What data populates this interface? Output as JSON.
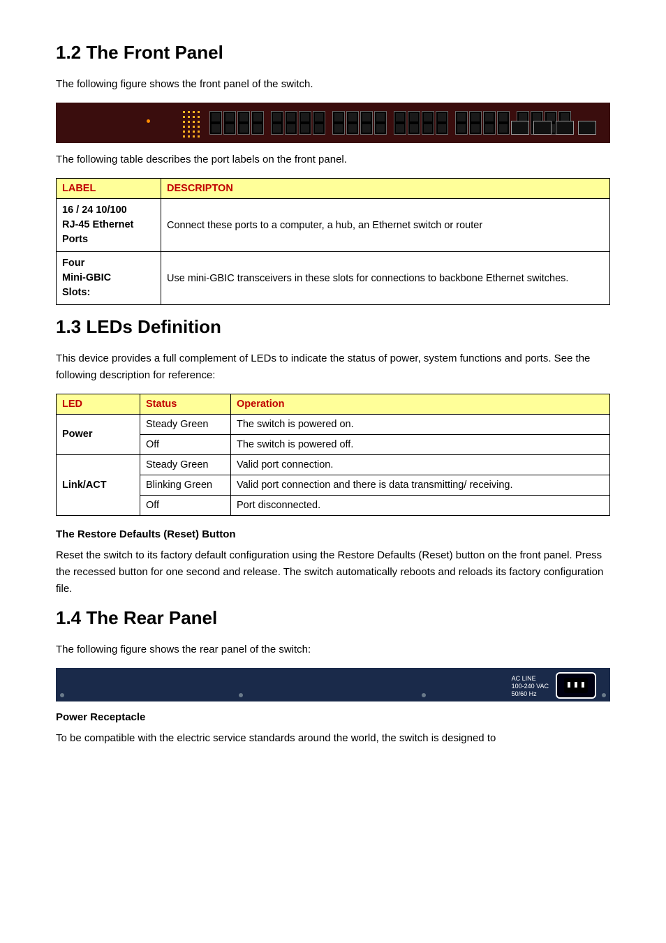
{
  "section_1_2": {
    "heading": "1.2 The Front Panel",
    "intro": "The following figure shows the front panel of the switch.",
    "caption": "The following table describes the port labels on the front panel.",
    "table": {
      "headers": [
        "LABEL",
        "DESCRIPTON"
      ],
      "rows": [
        {
          "label": "16 / 24 10/100\nRJ-45 Ethernet\nPorts",
          "desc": "Connect these ports to a computer, a hub, an Ethernet switch or router"
        },
        {
          "label": "Four\nMini-GBIC\nSlots:",
          "desc": "Use mini-GBIC transceivers in these slots for connections to backbone Ethernet switches."
        }
      ]
    }
  },
  "section_1_3": {
    "heading": "1.3 LEDs Definition",
    "intro": "This device provides a full complement of LEDs to indicate the status of power, system functions and ports. See the following description for reference:",
    "table": {
      "headers": [
        "LED",
        "Status",
        "Operation"
      ],
      "rows": [
        {
          "led": "Power",
          "status": "Steady Green",
          "op": "The switch is powered on."
        },
        {
          "led": "",
          "status": "Off",
          "op": "The switch is powered off."
        },
        {
          "led": "Link/ACT",
          "status": "Steady Green",
          "op": "Valid port connection."
        },
        {
          "led": "",
          "status": "Blinking Green",
          "op": "Valid port connection and there is data transmitting/ receiving."
        },
        {
          "led": "",
          "status": "Off",
          "op": "Port disconnected."
        }
      ]
    },
    "reset_heading": "The Restore Defaults (Reset) Button",
    "reset_body": "Reset the switch to its factory default configuration using the Restore Defaults (Reset) button on the front panel. Press the recessed button for one second and release. The switch automatically reboots and reloads its factory configuration file."
  },
  "section_1_4": {
    "heading": "1.4 The Rear Panel",
    "intro": "The following figure shows the rear panel of the switch:",
    "ac_label": "AC LINE\n100-240 VAC\n50/60 Hz",
    "receptacle_heading": "Power Receptacle",
    "receptacle_body": "To be compatible with the electric service standards around the world, the switch is designed to"
  }
}
